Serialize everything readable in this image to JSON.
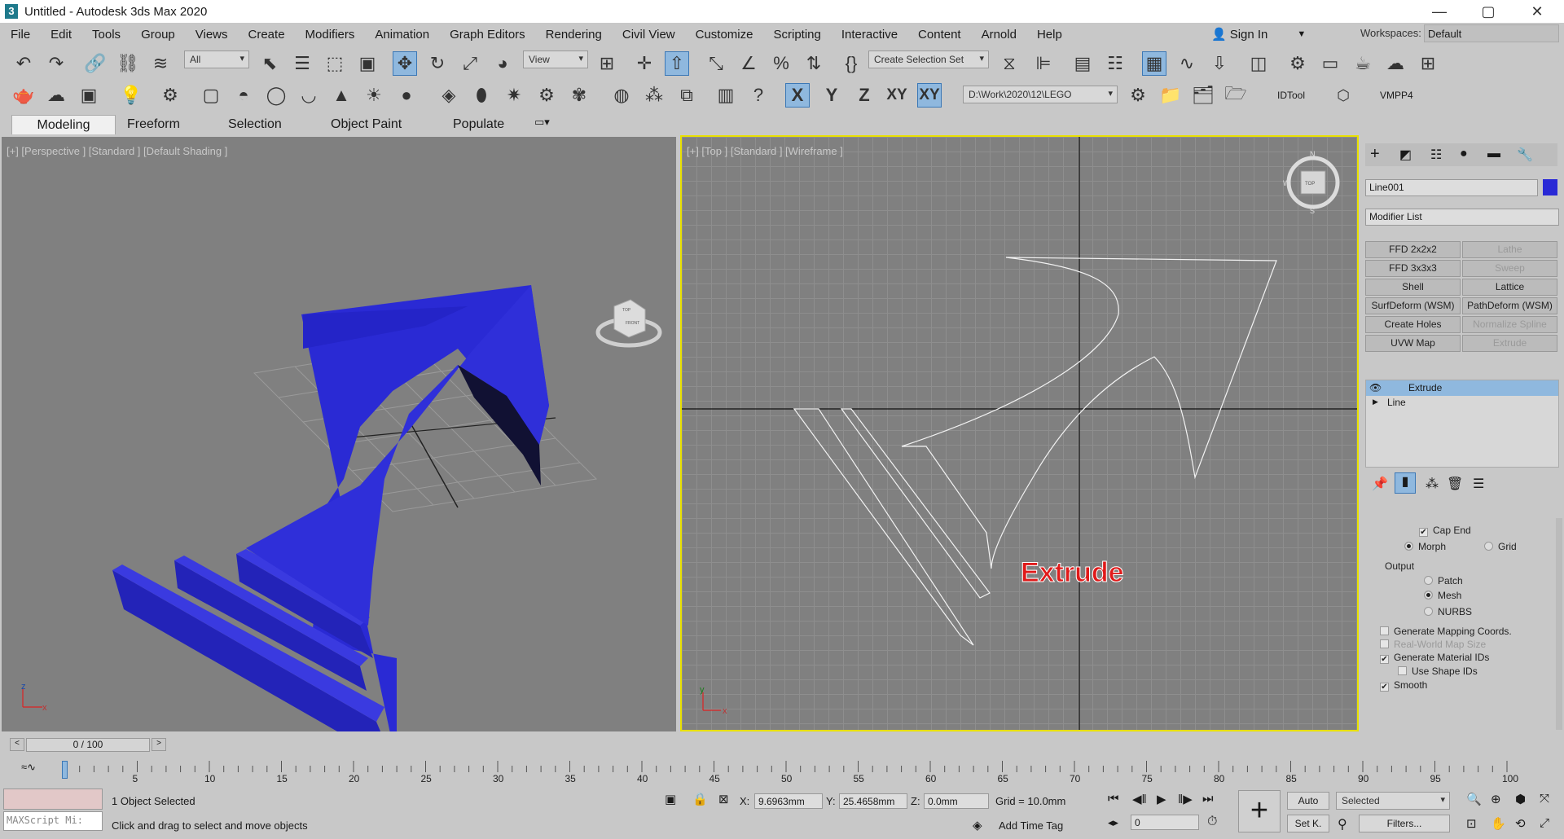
{
  "window": {
    "title": "Untitled - Autodesk 3ds Max 2020",
    "app_icon": "3",
    "minimize": "—",
    "maximize": "▢",
    "close": "✕"
  },
  "menu": [
    "File",
    "Edit",
    "Tools",
    "Group",
    "Views",
    "Create",
    "Modifiers",
    "Animation",
    "Graph Editors",
    "Rendering",
    "Civil View",
    "Customize",
    "Scripting",
    "Interactive",
    "Content",
    "Arnold",
    "Help"
  ],
  "account": {
    "sign_in": "Sign In",
    "workspaces_label": "Workspaces:",
    "workspace": "Default"
  },
  "toolbar": {
    "filter": "All",
    "ref_coord": "View",
    "selection_set": "Create Selection Set",
    "axis_x": "X",
    "axis_y": "Y",
    "axis_z": "Z",
    "axis_xy": "XY",
    "axis_xy2": "XY",
    "project_path": "D:\\Work\\2020\\12\\LEGO",
    "idtool": "IDTool",
    "vmpp": "VMPP4"
  },
  "ribbon": {
    "tabs": [
      "Modeling",
      "Freeform",
      "Selection",
      "Object Paint",
      "Populate"
    ],
    "selected": "Modeling"
  },
  "viewports": {
    "left_label": "[+] [Perspective ] [Standard ] [Default Shading ]",
    "right_label": "[+] [Top ] [Standard ] [Wireframe ]",
    "annotation": "Extrude",
    "viewcube_top": "TOP",
    "viewcube_front": "FRONT",
    "compass_n": "N",
    "compass_s": "S",
    "compass_w": "W",
    "axis_x": "x",
    "axis_y": "y",
    "axis_z": "z",
    "object_color": "#2a2ad4",
    "active_border": "#e8e000"
  },
  "command_panel": {
    "object_name": "Line001",
    "object_color": "#2929d6",
    "modifier_list": "Modifier List",
    "buttons": [
      {
        "label": "FFD 2x2x2",
        "enabled": true
      },
      {
        "label": "Lathe",
        "enabled": false
      },
      {
        "label": "FFD 3x3x3",
        "enabled": true
      },
      {
        "label": "Sweep",
        "enabled": false
      },
      {
        "label": "Shell",
        "enabled": true
      },
      {
        "label": "Lattice",
        "enabled": true
      },
      {
        "label": "SurfDeform (WSM)",
        "enabled": true
      },
      {
        "label": "PathDeform (WSM)",
        "enabled": true
      },
      {
        "label": "Create Holes",
        "enabled": true
      },
      {
        "label": "Normalize Spline",
        "enabled": false
      },
      {
        "label": "UVW Map",
        "enabled": true
      },
      {
        "label": "Extrude",
        "enabled": false
      }
    ],
    "stack": [
      {
        "label": "Extrude",
        "selected": true
      },
      {
        "label": "Line",
        "selected": false
      }
    ],
    "params": {
      "cap_end": "Cap End",
      "morph": "Morph",
      "grid": "Grid",
      "output": "Output",
      "patch": "Patch",
      "mesh": "Mesh",
      "nurbs": "NURBS",
      "gen_mapping": "Generate Mapping Coords.",
      "real_world": "Real-World Map Size",
      "gen_matids": "Generate Material IDs",
      "use_shape_ids": "Use Shape IDs",
      "smooth": "Smooth"
    }
  },
  "timeline": {
    "frame": "0 / 100",
    "ticks": [
      "5",
      "10",
      "15",
      "20",
      "25",
      "30",
      "35",
      "40",
      "45",
      "50",
      "55",
      "60",
      "65",
      "70",
      "75",
      "80",
      "85",
      "90",
      "95",
      "100"
    ]
  },
  "status": {
    "maxscript": "MAXScript Mi:",
    "selected": "1 Object Selected",
    "prompt": "Click and drag to select and move objects",
    "x_label": "X:",
    "x": "9.6963mm",
    "y_label": "Y:",
    "y": "25.4658mm",
    "z_label": "Z:",
    "z": "0.0mm",
    "grid": "Grid = 10.0mm",
    "add_time_tag": "Add Time Tag",
    "auto": "Auto",
    "selected_dd": "Selected",
    "set_key": "Set K.",
    "filters": "Filters...",
    "frame_field": "0"
  }
}
